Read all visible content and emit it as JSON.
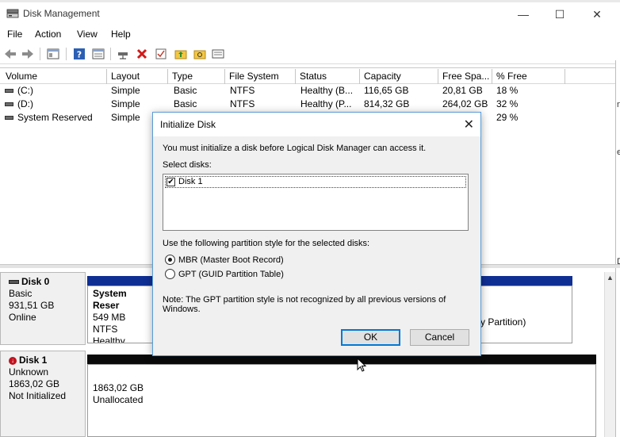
{
  "window": {
    "title": "Disk Management",
    "minimize": "—",
    "maximize": "☐",
    "close": "✕"
  },
  "menu": [
    "File",
    "Action",
    "View",
    "Help"
  ],
  "list": {
    "columns": [
      "Volume",
      "Layout",
      "Type",
      "File System",
      "Status",
      "Capacity",
      "Free Spa...",
      "% Free"
    ],
    "rows": [
      [
        "(C:)",
        "Simple",
        "Basic",
        "NTFS",
        "Healthy (B...",
        "116,65 GB",
        "20,81 GB",
        "18 %"
      ],
      [
        "(D:)",
        "Simple",
        "Basic",
        "NTFS",
        "Healthy (P...",
        "814,32 GB",
        "264,02 GB",
        "32 %"
      ],
      [
        "System Reserved",
        "Simple",
        "",
        "",
        "",
        "",
        "",
        "29 %"
      ]
    ]
  },
  "disks": [
    {
      "name": "Disk 0",
      "type": "Basic",
      "size": "931,51 GB",
      "state": "Online",
      "partition": {
        "name": "System Reser",
        "detail": "549 MB NTFS",
        "status": "Healthy (Syste"
      },
      "partition_right_status": "y Partition)"
    },
    {
      "name": "Disk 1",
      "type": "Unknown",
      "size": "1863,02 GB",
      "state": "Not Initialized",
      "partition": {
        "size": "1863,02 GB",
        "status": "Unallocated"
      }
    }
  ],
  "dialog": {
    "title": "Initialize Disk",
    "intro": "You must initialize a disk before Logical Disk Manager can access it.",
    "select_label": "Select disks:",
    "disk_item": "Disk 1",
    "style_label": "Use the following partition style for the selected disks:",
    "mbr": "MBR (Master Boot Record)",
    "gpt": "GPT (GUID Partition Table)",
    "note": "Note: The GPT partition style is not recognized by all previous versions of Windows.",
    "ok": "OK",
    "cancel": "Cancel"
  },
  "right_strip": [
    "n",
    "e",
    "D"
  ]
}
